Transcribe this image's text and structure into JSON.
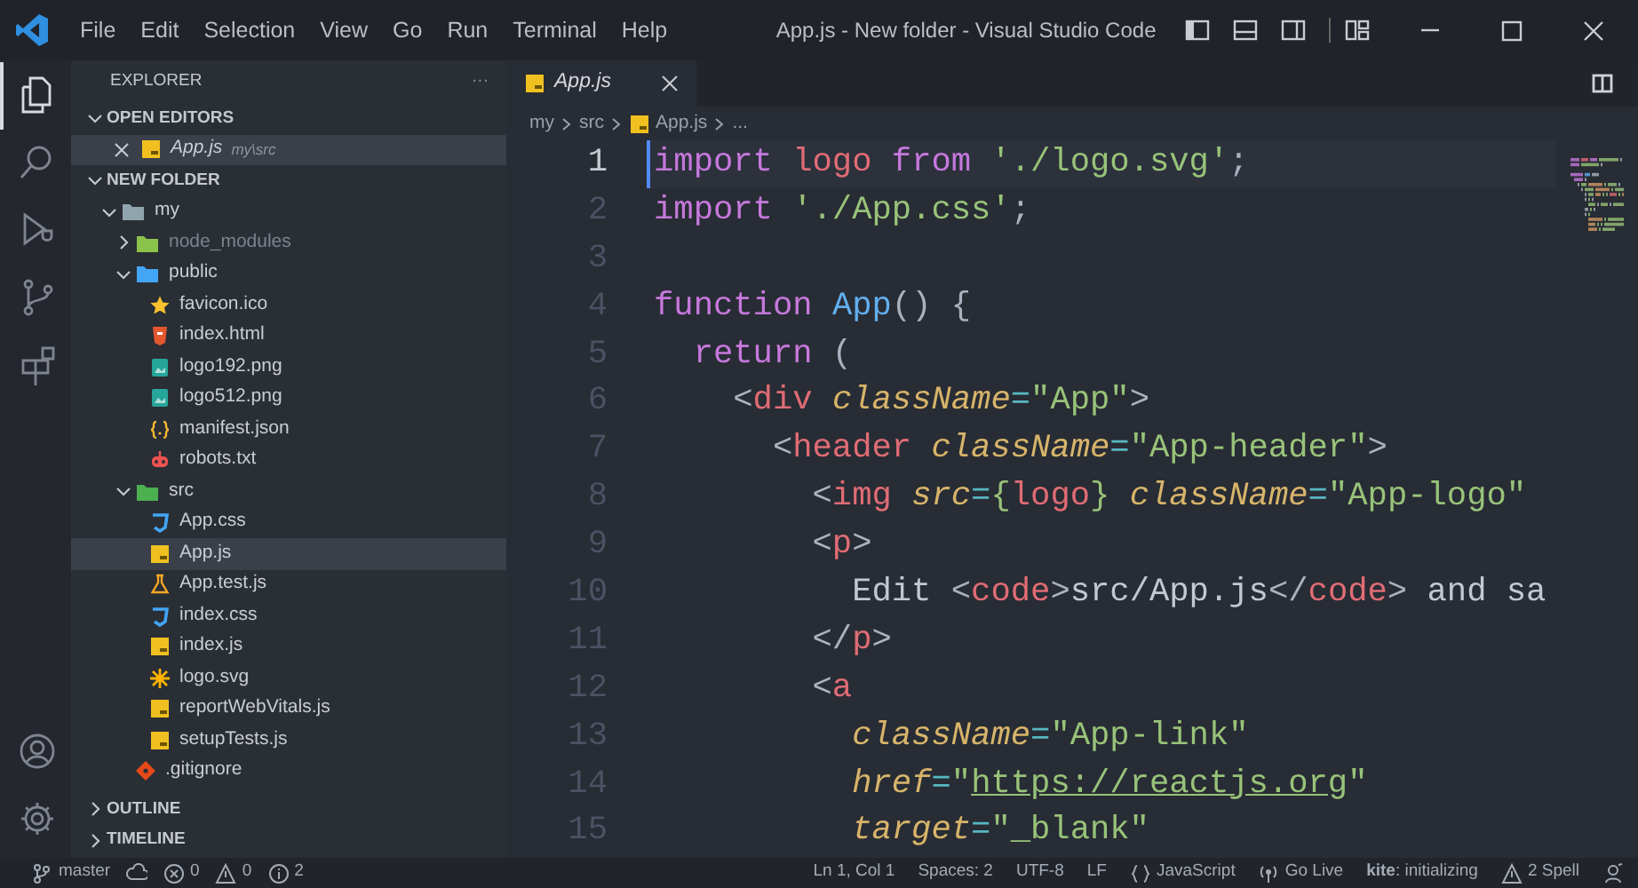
{
  "title_bar": {
    "menu": [
      "File",
      "Edit",
      "Selection",
      "View",
      "Go",
      "Run",
      "Terminal",
      "Help"
    ],
    "title": "App.js - New folder - Visual Studio Code"
  },
  "activity_bar": {
    "top": [
      {
        "kind": "files",
        "selected": true
      },
      {
        "kind": "search",
        "selected": false
      },
      {
        "kind": "debug",
        "selected": false
      },
      {
        "kind": "source-control",
        "selected": false
      },
      {
        "kind": "extensions",
        "selected": false
      }
    ],
    "bottom": [
      {
        "kind": "accounts",
        "selected": false
      },
      {
        "kind": "settings",
        "selected": false
      }
    ]
  },
  "sidebar": {
    "title": "EXPLORER",
    "actions": "···",
    "open_editors": {
      "label": "OPEN EDITORS",
      "expanded": true,
      "items": [
        {
          "label": "App.js",
          "description": "my\\src",
          "kind": "js",
          "selected": true
        }
      ]
    },
    "folder": {
      "label": "NEW FOLDER",
      "expanded": true,
      "items": [
        {
          "label": "my",
          "kind": "folder",
          "expanded": true,
          "selected": false,
          "ignored": false,
          "children": [
            {
              "label": "node_modules",
              "kind": "folder-node",
              "expanded": false,
              "selected": false,
              "ignored": true
            },
            {
              "label": "public",
              "kind": "folder-public",
              "expanded": true,
              "selected": false,
              "ignored": false,
              "children": [
                {
                  "label": "favicon.ico",
                  "kind": "star",
                  "selected": false,
                  "ignored": false
                },
                {
                  "label": "index.html",
                  "kind": "html",
                  "selected": false,
                  "ignored": false
                },
                {
                  "label": "logo192.png",
                  "kind": "image",
                  "selected": false,
                  "ignored": false
                },
                {
                  "label": "logo512.png",
                  "kind": "image",
                  "selected": false,
                  "ignored": false
                },
                {
                  "label": "manifest.json",
                  "kind": "json",
                  "selected": false,
                  "ignored": false
                },
                {
                  "label": "robots.txt",
                  "kind": "robot",
                  "selected": false,
                  "ignored": false
                }
              ]
            },
            {
              "label": "src",
              "kind": "folder-src",
              "expanded": true,
              "selected": false,
              "ignored": false,
              "children": [
                {
                  "label": "App.css",
                  "kind": "css",
                  "selected": false,
                  "ignored": false
                },
                {
                  "label": "App.js",
                  "kind": "js",
                  "selected": true,
                  "ignored": false
                },
                {
                  "label": "App.test.js",
                  "kind": "test",
                  "selected": false,
                  "ignored": false
                },
                {
                  "label": "index.css",
                  "kind": "css",
                  "selected": false,
                  "ignored": false
                },
                {
                  "label": "index.js",
                  "kind": "js",
                  "selected": false,
                  "ignored": false
                },
                {
                  "label": "logo.svg",
                  "kind": "svg",
                  "selected": false,
                  "ignored": false
                },
                {
                  "label": "reportWebVitals.js",
                  "kind": "js",
                  "selected": false,
                  "ignored": false
                },
                {
                  "label": "setupTests.js",
                  "kind": "js",
                  "selected": false,
                  "ignored": false
                }
              ]
            },
            {
              "label": ".gitignore",
              "kind": "git",
              "selected": false,
              "ignored": false
            }
          ]
        }
      ]
    },
    "bottom_sections": [
      {
        "label": "OUTLINE",
        "expanded": false
      },
      {
        "label": "TIMELINE",
        "expanded": false
      }
    ]
  },
  "editor": {
    "tabs": [
      {
        "label": "App.js",
        "kind": "js",
        "selected": true
      }
    ],
    "breadcrumb": [
      {
        "label": "my"
      },
      {
        "label": "src"
      },
      {
        "label": "App.js",
        "kind": "js"
      },
      {
        "label": "..."
      }
    ],
    "lines": [
      {
        "number": "1",
        "current": true,
        "tokens": [
          {
            "kind": "keyword",
            "text": "import "
          },
          {
            "kind": "var",
            "text": "logo "
          },
          {
            "kind": "keyword",
            "text": "from "
          },
          {
            "kind": "str",
            "text": "'./logo.svg'"
          },
          {
            "kind": "punct",
            "text": ";"
          }
        ]
      },
      {
        "number": "2",
        "current": false,
        "tokens": [
          {
            "kind": "keyword",
            "text": "import "
          },
          {
            "kind": "str",
            "text": "'./App.css'"
          },
          {
            "kind": "punct",
            "text": ";"
          }
        ]
      },
      {
        "number": "3",
        "current": false
      },
      {
        "number": "4",
        "current": false,
        "tokens": [
          {
            "kind": "keyword",
            "text": "function "
          },
          {
            "kind": "fn",
            "text": "App"
          },
          {
            "kind": "punct",
            "text": "() {"
          }
        ]
      },
      {
        "number": "5",
        "current": false,
        "tokens": [
          {
            "kind": "keyword",
            "text": "  return "
          },
          {
            "kind": "punct",
            "text": "("
          }
        ]
      },
      {
        "number": "6",
        "current": false,
        "tokens": [
          {
            "kind": "punct",
            "text": "    <"
          },
          {
            "kind": "tag",
            "text": "div "
          },
          {
            "kind": "attr",
            "text": "className"
          },
          {
            "kind": "op",
            "text": "="
          },
          {
            "kind": "str",
            "text": "\"App\""
          },
          {
            "kind": "punct",
            "text": ">"
          }
        ]
      },
      {
        "number": "7",
        "current": false,
        "tokens": [
          {
            "kind": "punct",
            "text": "      <"
          },
          {
            "kind": "tag",
            "text": "header "
          },
          {
            "kind": "attr",
            "text": "className"
          },
          {
            "kind": "op",
            "text": "="
          },
          {
            "kind": "str",
            "text": "\"App-header\""
          },
          {
            "kind": "punct",
            "text": ">"
          }
        ]
      },
      {
        "number": "8",
        "current": false,
        "tokens": [
          {
            "kind": "punct",
            "text": "        <"
          },
          {
            "kind": "tag",
            "text": "img "
          },
          {
            "kind": "attr",
            "text": "src"
          },
          {
            "kind": "op",
            "text": "="
          },
          {
            "kind": "brace",
            "text": "{"
          },
          {
            "kind": "var",
            "text": "logo"
          },
          {
            "kind": "brace",
            "text": "} "
          },
          {
            "kind": "attr",
            "text": "className"
          },
          {
            "kind": "op",
            "text": "="
          },
          {
            "kind": "str",
            "text": "\"App-logo\""
          }
        ]
      },
      {
        "number": "9",
        "current": false,
        "tokens": [
          {
            "kind": "punct",
            "text": "        <"
          },
          {
            "kind": "tag",
            "text": "p"
          },
          {
            "kind": "punct",
            "text": ">"
          }
        ]
      },
      {
        "number": "10",
        "current": false,
        "tokens": [
          {
            "kind": "text",
            "text": "          Edit "
          },
          {
            "kind": "punct",
            "text": "<"
          },
          {
            "kind": "tag",
            "text": "code"
          },
          {
            "kind": "punct",
            "text": ">"
          },
          {
            "kind": "text",
            "text": "src/App.js"
          },
          {
            "kind": "punct",
            "text": "</"
          },
          {
            "kind": "tag",
            "text": "code"
          },
          {
            "kind": "punct",
            "text": ">"
          },
          {
            "kind": "text",
            "text": " and sa"
          }
        ]
      },
      {
        "number": "11",
        "current": false,
        "tokens": [
          {
            "kind": "punct",
            "text": "        </"
          },
          {
            "kind": "tag",
            "text": "p"
          },
          {
            "kind": "punct",
            "text": ">"
          }
        ]
      },
      {
        "number": "12",
        "current": false,
        "tokens": [
          {
            "kind": "punct",
            "text": "        <"
          },
          {
            "kind": "tag",
            "text": "a"
          }
        ]
      },
      {
        "number": "13",
        "current": false,
        "tokens": [
          {
            "kind": "attr",
            "text": "          className"
          },
          {
            "kind": "op",
            "text": "="
          },
          {
            "kind": "str",
            "text": "\"App-link\""
          }
        ]
      },
      {
        "number": "14",
        "current": false,
        "tokens": [
          {
            "kind": "attr",
            "text": "          href"
          },
          {
            "kind": "op",
            "text": "="
          },
          {
            "kind": "str",
            "text": "\""
          },
          {
            "kind": "url",
            "text": "https://reactjs.org"
          },
          {
            "kind": "str",
            "text": "\""
          }
        ]
      },
      {
        "number": "15",
        "current": false,
        "tokens": [
          {
            "kind": "attr",
            "text": "          target"
          },
          {
            "kind": "op",
            "text": "="
          },
          {
            "kind": "str",
            "text": "\"_blank\""
          }
        ]
      }
    ]
  },
  "status_bar": {
    "left": [
      {
        "kind": "branch",
        "text": "master"
      },
      {
        "kind": "sync"
      },
      {
        "kind": "errors",
        "text": "0"
      },
      {
        "kind": "warnings",
        "text": "0"
      },
      {
        "kind": "info",
        "text": "2"
      }
    ],
    "right": [
      {
        "kind": "plain",
        "text": "Ln 1, Col 1"
      },
      {
        "kind": "plain",
        "text": "Spaces: 2"
      },
      {
        "kind": "plain",
        "text": "UTF-8"
      },
      {
        "kind": "plain",
        "text": "LF"
      },
      {
        "kind": "language",
        "text": "JavaScript"
      },
      {
        "kind": "golive",
        "text": "Go Live"
      },
      {
        "kind": "plain",
        "text": "**kite**: initializing"
      },
      {
        "kind": "spell",
        "text": "2 Spell"
      },
      {
        "kind": "feedback"
      }
    ]
  }
}
